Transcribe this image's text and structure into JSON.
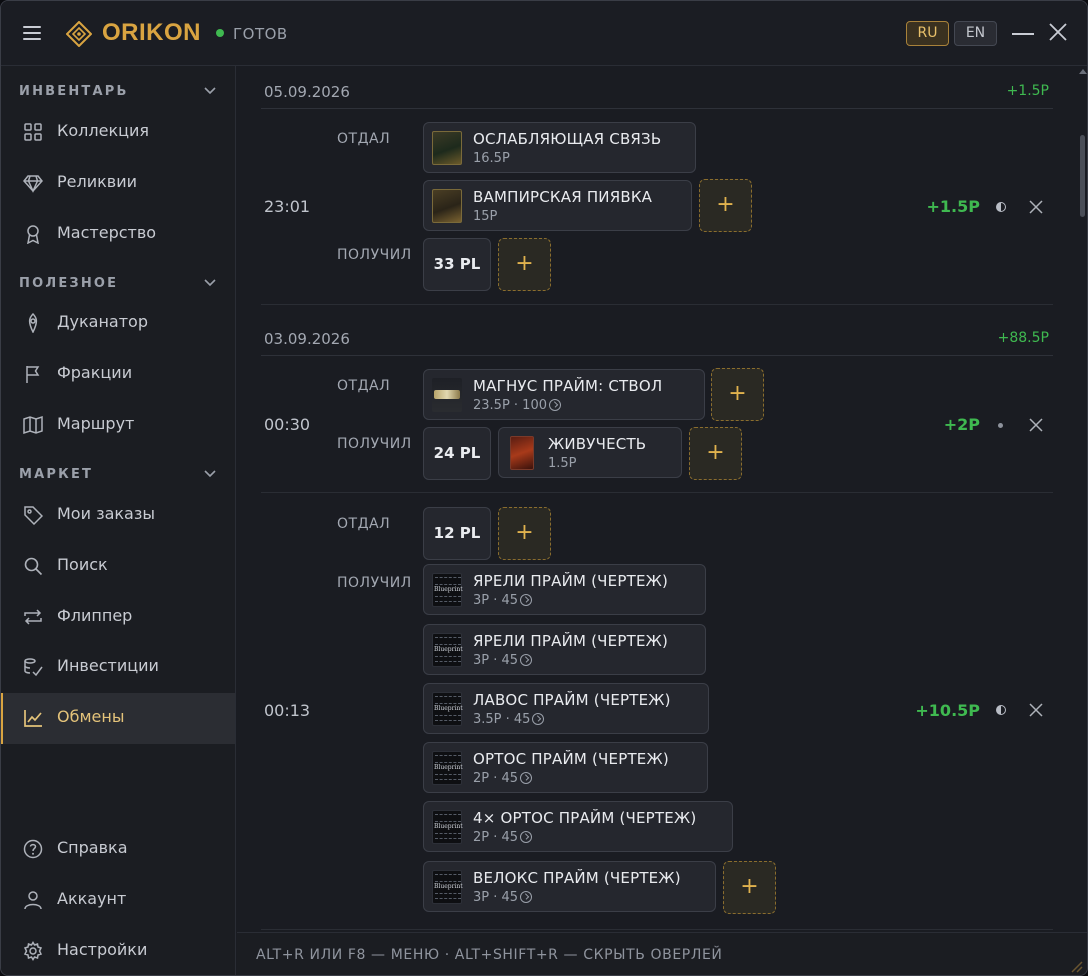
{
  "app": {
    "name": "ORIKON",
    "status": "ГОТОВ",
    "colors": {
      "accent": "#d9a441",
      "positive": "#3fb950",
      "background": "#1a1c22"
    },
    "languages": [
      "RU",
      "EN"
    ],
    "active_language": "RU"
  },
  "sidebar": {
    "sections": [
      {
        "title": "ИНВЕНТАРЬ",
        "items": [
          {
            "label": "Коллекция",
            "icon": "grid-icon"
          },
          {
            "label": "Реликвии",
            "icon": "gem-icon"
          },
          {
            "label": "Мастерство",
            "icon": "medal-icon"
          }
        ]
      },
      {
        "title": "ПОЛЕЗНОЕ",
        "items": [
          {
            "label": "Дуканатор",
            "icon": "ducat-icon"
          },
          {
            "label": "Фракции",
            "icon": "flag-icon"
          },
          {
            "label": "Маршрут",
            "icon": "map-icon"
          }
        ]
      },
      {
        "title": "МАРКЕТ",
        "items": [
          {
            "label": "Мои заказы",
            "icon": "tag-icon"
          },
          {
            "label": "Поиск",
            "icon": "search-icon"
          },
          {
            "label": "Флиппер",
            "icon": "swap-icon"
          },
          {
            "label": "Инвестиции",
            "icon": "invest-icon"
          },
          {
            "label": "Обмены",
            "icon": "chart-icon",
            "active": true
          }
        ]
      }
    ],
    "bottom": [
      {
        "label": "Справка",
        "icon": "help-icon"
      },
      {
        "label": "Аккаунт",
        "icon": "user-icon"
      },
      {
        "label": "Настройки",
        "icon": "gear-icon"
      }
    ]
  },
  "labels": {
    "gave": "ОТДАЛ",
    "got": "ПОЛУЧИЛ",
    "add": "+"
  },
  "groups": [
    {
      "date": "05.09.2026",
      "total": "+1.5P"
    },
    {
      "date": "03.09.2026",
      "total": "+88.5P"
    }
  ],
  "trades": [
    {
      "time": "23:01",
      "total": "+1.5P",
      "status_icon": "half-circle-icon",
      "gave": [
        {
          "name": "ОСЛАБЛЯЮЩАЯ СВЯЗЬ",
          "sub": "16.5P",
          "thumb": "mod-card"
        },
        {
          "name": "ВАМПИРСКАЯ ПИЯВКА",
          "sub": "15P",
          "thumb": "mod-card"
        }
      ],
      "got": [
        {
          "platinum": "33 PL"
        }
      ]
    },
    {
      "time": "00:30",
      "total": "+2P",
      "status_icon": "dot-icon",
      "gave": [
        {
          "name": "МАГНУС ПРАЙМ: СТВОЛ",
          "sub": "23.5P · 100",
          "thumb": "part-image",
          "ducats": true
        }
      ],
      "got": [
        {
          "platinum": "24 PL"
        },
        {
          "name": "ЖИВУЧЕСТЬ",
          "sub": "1.5P",
          "thumb": "mod-card-red"
        }
      ]
    },
    {
      "time": "00:13",
      "total": "+10.5P",
      "status_icon": "half-circle-icon",
      "gave": [
        {
          "platinum": "12 PL"
        }
      ],
      "got": [
        {
          "name": "ЯРЕЛИ ПРАЙМ (ЧЕРТЕЖ)",
          "sub": "3P · 45",
          "thumb": "blueprint",
          "ducats": true
        },
        {
          "name": "ЯРЕЛИ ПРАЙМ (ЧЕРТЕЖ)",
          "sub": "3P · 45",
          "thumb": "blueprint",
          "ducats": true
        },
        {
          "name": "ЛАВОС ПРАЙМ (ЧЕРТЕЖ)",
          "sub": "3.5P · 45",
          "thumb": "blueprint",
          "ducats": true
        },
        {
          "name": "ОРТОС ПРАЙМ (ЧЕРТЕЖ)",
          "sub": "2P · 45",
          "thumb": "blueprint",
          "ducats": true
        },
        {
          "name": "4× ОРТОС ПРАЙМ (ЧЕРТЕЖ)",
          "sub": "2P · 45",
          "thumb": "blueprint",
          "ducats": true
        },
        {
          "name": "ВЕЛОКС ПРАЙМ (ЧЕРТЕЖ)",
          "sub": "3P · 45",
          "thumb": "blueprint",
          "ducats": true
        }
      ]
    }
  ],
  "footer": {
    "hint": "ALT+R ИЛИ F8 — МЕНЮ · ALT+SHIFT+R — СКРЫТЬ ОВЕРЛЕЙ"
  }
}
